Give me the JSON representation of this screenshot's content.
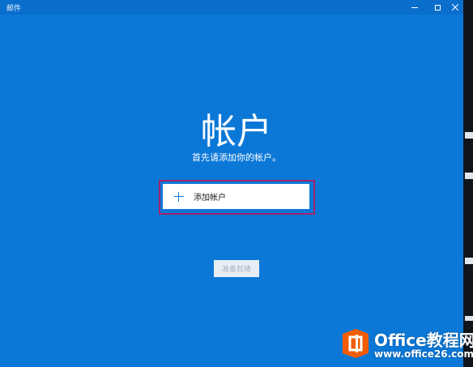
{
  "window": {
    "title": "邮件"
  },
  "main": {
    "heading": "帐户",
    "subtitle": "首先请添加你的帐户。",
    "add_account_label": "添加帐户",
    "ready_label": "准备就绪"
  },
  "watermark": {
    "title": "Office教程网",
    "url": "www.office26.com"
  },
  "colors": {
    "background": "#0b78d8",
    "highlight_border": "#a3236a",
    "logo_orange": "#f25c05"
  }
}
